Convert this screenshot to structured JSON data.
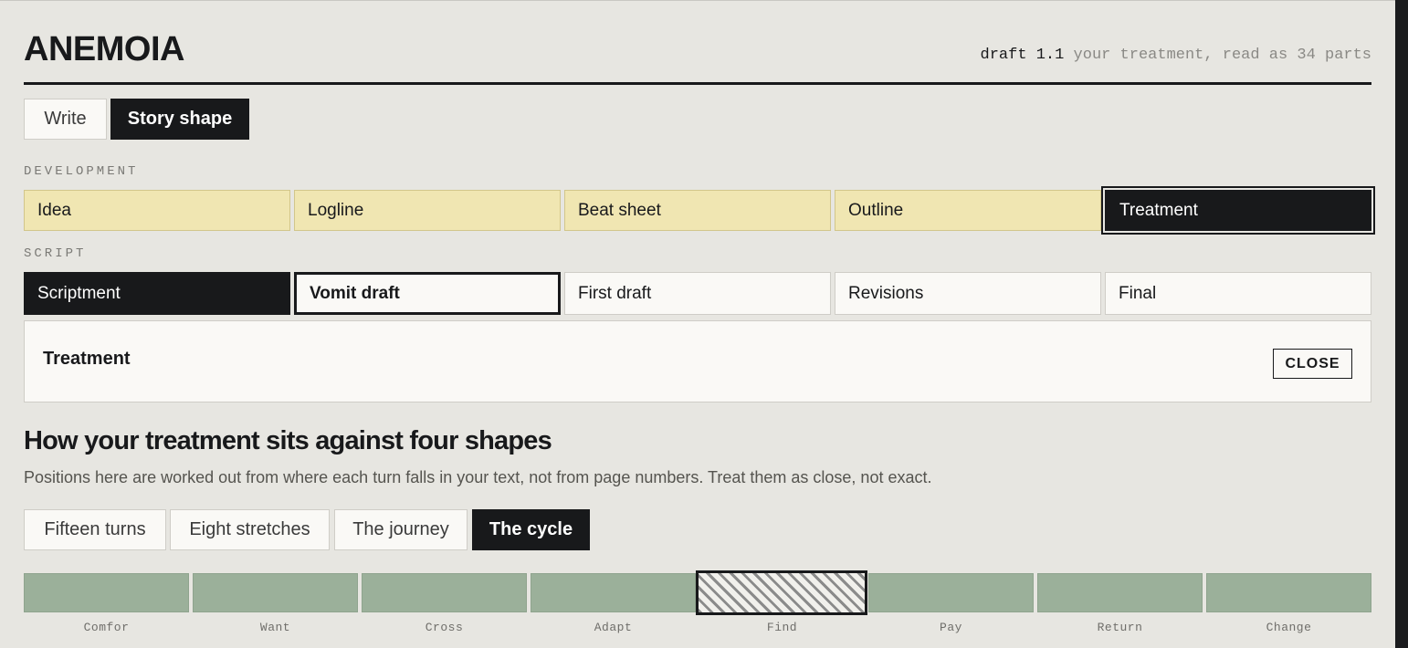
{
  "app": {
    "title": "ANEMOIA"
  },
  "header_meta": {
    "draft": "draft 1.1",
    "description": "your treatment, read as 34 parts"
  },
  "mode_tabs": [
    {
      "label": "Write",
      "active": false
    },
    {
      "label": "Story shape",
      "active": true
    }
  ],
  "development": {
    "label": "DEVELOPMENT",
    "stages": [
      "Idea",
      "Logline",
      "Beat sheet",
      "Outline",
      "Treatment"
    ],
    "selected": "Treatment"
  },
  "script": {
    "label": "SCRIPT",
    "stages": [
      "Scriptment",
      "Vomit draft",
      "First draft",
      "Revisions",
      "Final"
    ]
  },
  "detail_panel": {
    "title": "Treatment",
    "close_label": "CLOSE"
  },
  "shapes": {
    "heading": "How your treatment sits against four shapes",
    "subtitle": "Positions here are worked out from where each turn falls in your text, not from page numbers. Treat them as close, not exact.",
    "tabs": [
      {
        "label": "Fifteen turns",
        "active": false
      },
      {
        "label": "Eight stretches",
        "active": false
      },
      {
        "label": "The journey",
        "active": false
      },
      {
        "label": "The cycle",
        "active": true
      }
    ]
  },
  "cycle": {
    "steps": [
      "Comfor",
      "Want",
      "Cross",
      "Adapt",
      "Find",
      "Pay",
      "Return",
      "Change"
    ],
    "highlighted": "Find"
  },
  "colors": {
    "dev_fill": "#f0e6b2",
    "cycle_fill": "#9bb09a",
    "ink": "#18191b",
    "paper": "#e7e6e1"
  }
}
